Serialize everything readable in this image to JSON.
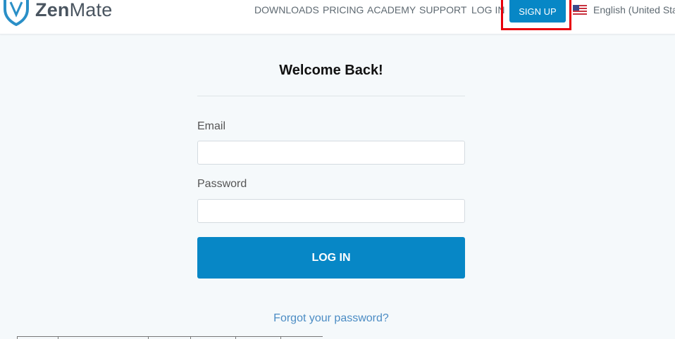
{
  "header": {
    "logo_text_bold": "Zen",
    "logo_text_light": "Mate",
    "nav": {
      "downloads": "DOWNLOADS",
      "pricing": "PRICING",
      "academy": "ACADEMY",
      "support": "SUPPORT",
      "login": "LOG IN"
    },
    "signup_label": "SIGN UP",
    "language": "English (United States)",
    "flag_icon": "us-flag-icon"
  },
  "form": {
    "title": "Welcome Back!",
    "email_label": "Email",
    "email_value": "",
    "password_label": "Password",
    "password_value": "",
    "login_button": "LOG IN",
    "forgot_link": "Forgot your password?"
  },
  "colors": {
    "accent": "#0787c6",
    "highlight": "#e8000c",
    "link": "#4b8cc4",
    "background": "#f5f9fb"
  }
}
